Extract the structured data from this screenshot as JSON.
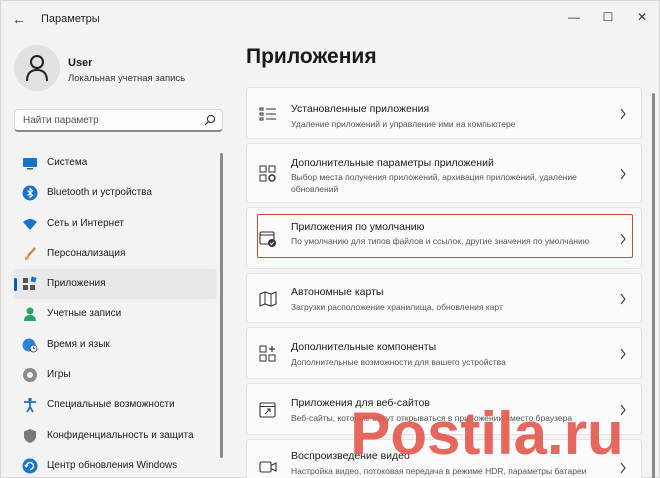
{
  "window": {
    "title": "Параметры"
  },
  "profile": {
    "name": "User",
    "subtitle": "Локальная учетная запись"
  },
  "search": {
    "placeholder": "Найти параметр"
  },
  "nav": [
    {
      "label": "Система",
      "icon": "monitor-icon",
      "active": false
    },
    {
      "label": "Bluetooth и устройства",
      "icon": "bluetooth-icon",
      "active": false
    },
    {
      "label": "Сеть и Интернет",
      "icon": "wifi-icon",
      "active": false
    },
    {
      "label": "Персонализация",
      "icon": "brush-icon",
      "active": false
    },
    {
      "label": "Приложения",
      "icon": "apps-icon",
      "active": true
    },
    {
      "label": "Учетные записи",
      "icon": "person-icon",
      "active": false
    },
    {
      "label": "Время и язык",
      "icon": "globe-clock-icon",
      "active": false
    },
    {
      "label": "Игры",
      "icon": "gamepad-icon",
      "active": false
    },
    {
      "label": "Специальные возможности",
      "icon": "accessibility-icon",
      "active": false
    },
    {
      "label": "Конфиденциальность и защита",
      "icon": "shield-icon",
      "active": false
    },
    {
      "label": "Центр обновления Windows",
      "icon": "update-icon",
      "active": false
    }
  ],
  "page": {
    "title": "Приложения"
  },
  "cards": [
    {
      "title": "Установленные приложения",
      "description": "Удаление приложений и управление ими на компьютере",
      "icon": "list-icon"
    },
    {
      "title": "Дополнительные параметры приложений",
      "description": "Выбор места получения приложений, архивация приложений, удаление обновлений",
      "icon": "app-settings-icon"
    },
    {
      "title": "Приложения по умолчанию",
      "description": "По умолчанию для типов файлов и ссылок, другие значения по умолчанию",
      "icon": "default-apps-icon",
      "highlighted": true
    },
    {
      "title": "Автономные карты",
      "description": "Загрузки расположение хранилища, обновления карт",
      "icon": "map-icon"
    },
    {
      "title": "Дополнительные компоненты",
      "description": "Дополнительные возможности для вашего устройства",
      "icon": "add-components-icon"
    },
    {
      "title": "Приложения для веб-сайтов",
      "description": "Веб-сайты, которые могут открываться в приложении вместо браузера",
      "icon": "web-apps-icon"
    },
    {
      "title": "Воспроизведение видео",
      "description": "Настройка видео, потоковая передача в режиме HDR, параметры батареи",
      "icon": "video-icon"
    }
  ],
  "watermark": {
    "text": "Postila.ru"
  },
  "colors": {
    "accent": "#005fb8",
    "highlight_border": "#d0453c",
    "watermark": "#e2574c"
  }
}
